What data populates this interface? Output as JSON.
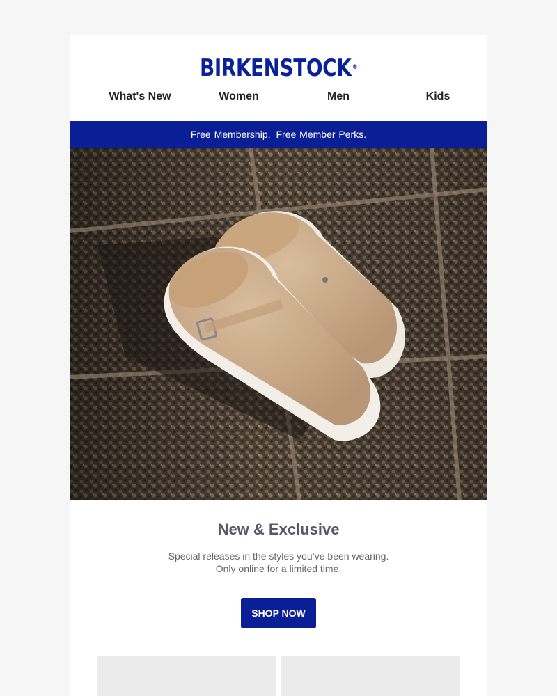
{
  "brand": {
    "logo_text": "BIRKENSTOCK",
    "registered_mark": "®",
    "color": "#0b2199"
  },
  "nav": {
    "items": [
      {
        "label": "What's New"
      },
      {
        "label": "Women"
      },
      {
        "label": "Men"
      },
      {
        "label": "Kids"
      }
    ]
  },
  "banner": {
    "part1": "Free Membership.",
    "part2": "Free Member Perks.",
    "background": "#0a1f96"
  },
  "hero": {
    "image": "clog-photo"
  },
  "content": {
    "headline": "New & Exclusive",
    "subtext_line1": "Special releases in the styles you’ve been wearing.",
    "subtext_line2": "Only online for a limited time.",
    "cta_label": "SHOP NOW"
  }
}
